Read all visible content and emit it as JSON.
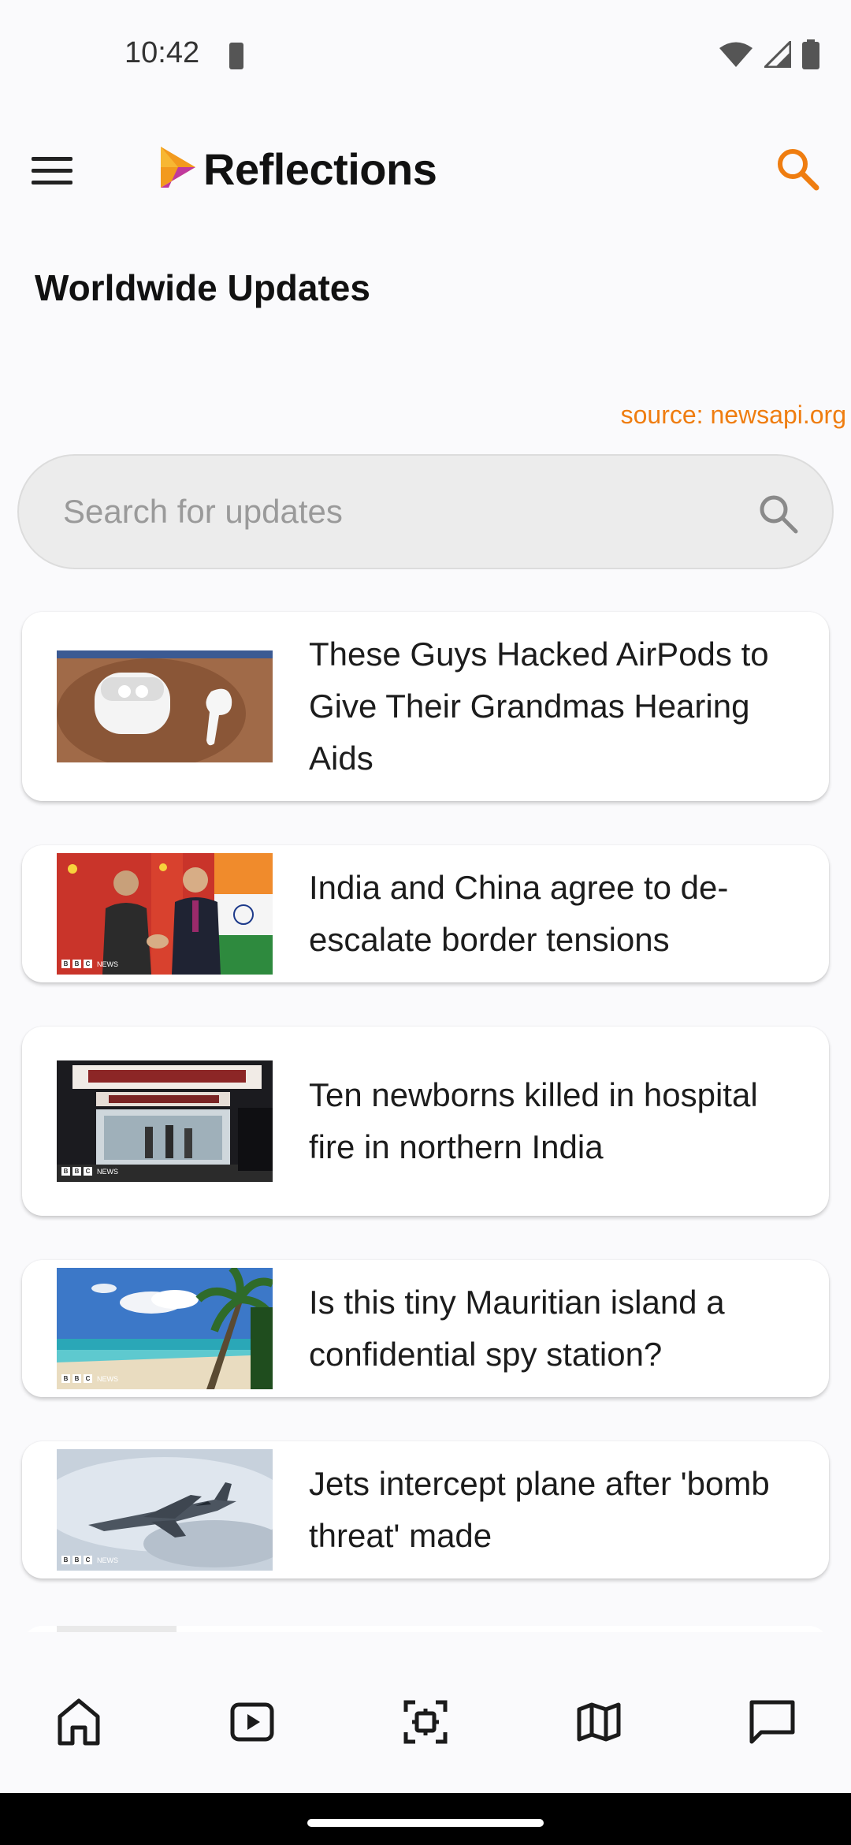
{
  "status_bar": {
    "time": "10:42"
  },
  "app_bar": {
    "title": "Reflections"
  },
  "section": {
    "title": "Worldwide Updates",
    "source": "source: newsapi.org"
  },
  "search": {
    "placeholder": "Search for updates",
    "value": ""
  },
  "news": [
    {
      "headline": "These Guys Hacked AirPods to Give Their Grandmas Hearing Aids",
      "thumbnail": "airpods-photo"
    },
    {
      "headline": "India and China agree to de-escalate border tensions",
      "thumbnail": "leaders-handshake-photo"
    },
    {
      "headline": "Ten newborns killed in hospital fire in northern India",
      "thumbnail": "hospital-entrance-photo"
    },
    {
      "headline": "Is this tiny Mauritian island a confidential spy station?",
      "thumbnail": "tropical-beach-photo"
    },
    {
      "headline": "Jets intercept plane after 'bomb threat' made",
      "thumbnail": "fighter-jet-photo"
    }
  ],
  "bottom_nav": [
    "home-icon",
    "video-icon",
    "scan-icon",
    "map-icon",
    "chat-icon"
  ],
  "colors": {
    "accent": "#ef7d10",
    "background": "#fafafc",
    "card": "#ffffff",
    "search_bg": "#ececec"
  }
}
